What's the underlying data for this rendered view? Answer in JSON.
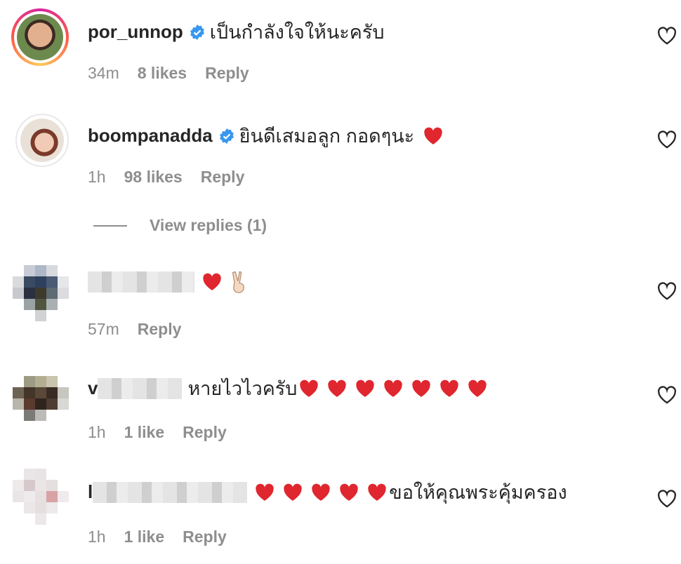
{
  "comments": [
    {
      "username": "por_unnop",
      "verified": true,
      "text": "เป็นกำลังใจให้นะครับ",
      "time": "34m",
      "likes": "8 likes",
      "reply_label": "Reply"
    },
    {
      "username": "boompanadda",
      "verified": true,
      "text": "ยินดีเสมอลูก กอดๆนะ",
      "emoji": "❤️",
      "time": "1h",
      "likes": "98 likes",
      "reply_label": "Reply",
      "view_replies": "View replies (1)"
    },
    {
      "username": "",
      "emoji": "❤️ ✌🏻",
      "time": "57m",
      "reply_label": "Reply"
    },
    {
      "username_initial": "v",
      "text": "หายไวไวครับ",
      "time": "1h",
      "likes": "1 like",
      "reply_label": "Reply"
    },
    {
      "username_initial": "l",
      "text": "ขอให้คุณพระคุ้มครอง",
      "time": "1h",
      "likes": "1 like",
      "reply_label": "Reply"
    }
  ],
  "colors": {
    "heart_red": "#e0262e",
    "verified_blue": "#3897f0",
    "meta_grey": "#8e8e8e"
  }
}
